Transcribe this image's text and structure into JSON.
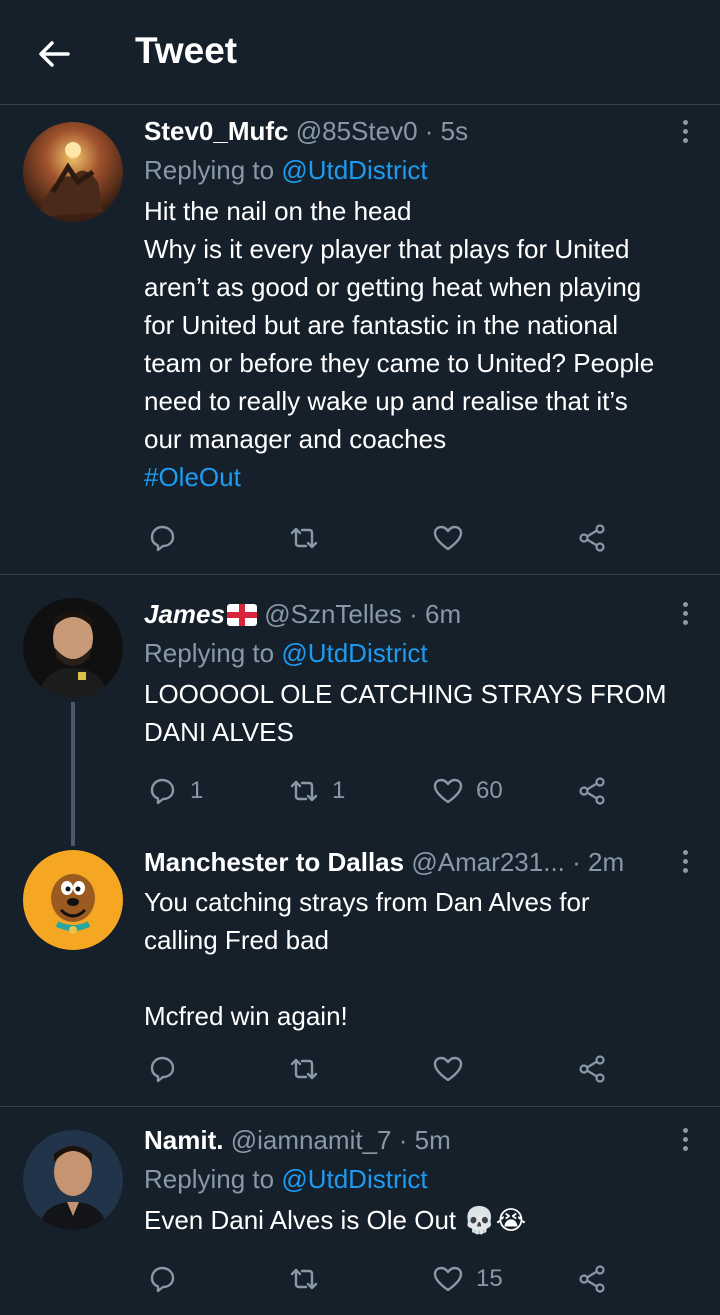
{
  "header": {
    "title": "Tweet"
  },
  "tweets": [
    {
      "name": "Stev0_Mufc",
      "handle": "@85Stev0",
      "time": "· 5s",
      "reply_prefix": "Replying to",
      "reply_to": "@UtdDistrict",
      "text": "Hit the nail on the head\nWhy is it every player that plays for United aren’t as good or getting heat when playing for United but are fantastic in the national team or before they came to United? People need to really wake up and realise that it’s our manager and coaches",
      "hashtag": "#OleOut",
      "replies": "",
      "retweets": "",
      "likes": ""
    },
    {
      "name": "James",
      "flag": "england-flag",
      "handle": "@SznTelles",
      "time": "· 6m",
      "reply_prefix": "Replying to",
      "reply_to": "@UtdDistrict",
      "text": "LOOOOOL OLE CATCHING STRAYS FROM DANI ALVES",
      "replies": "1",
      "retweets": "1",
      "likes": "60"
    },
    {
      "name": "Manchester to Dallas",
      "handle": "@Amar231...",
      "time": "· 2m",
      "text": "You catching strays from Dan Alves for calling Fred bad\n\nMcfred win again!",
      "replies": "",
      "retweets": "",
      "likes": ""
    },
    {
      "name": "Namit.",
      "handle": "@iamnamit_7",
      "time": "· 5m",
      "reply_prefix": "Replying to",
      "reply_to": "@UtdDistrict",
      "text": "Even Dani Alves is Ole Out",
      "emoji": "💀😭",
      "replies": "",
      "retweets": "",
      "likes": "15"
    }
  ],
  "colors": {
    "background": "#15202b",
    "secondary_text": "#8899a6",
    "link": "#1d9bf0",
    "divider": "#38444d"
  },
  "icons": [
    "back-arrow-icon",
    "more-icon",
    "reply-icon",
    "retweet-icon",
    "like-icon",
    "share-icon"
  ]
}
